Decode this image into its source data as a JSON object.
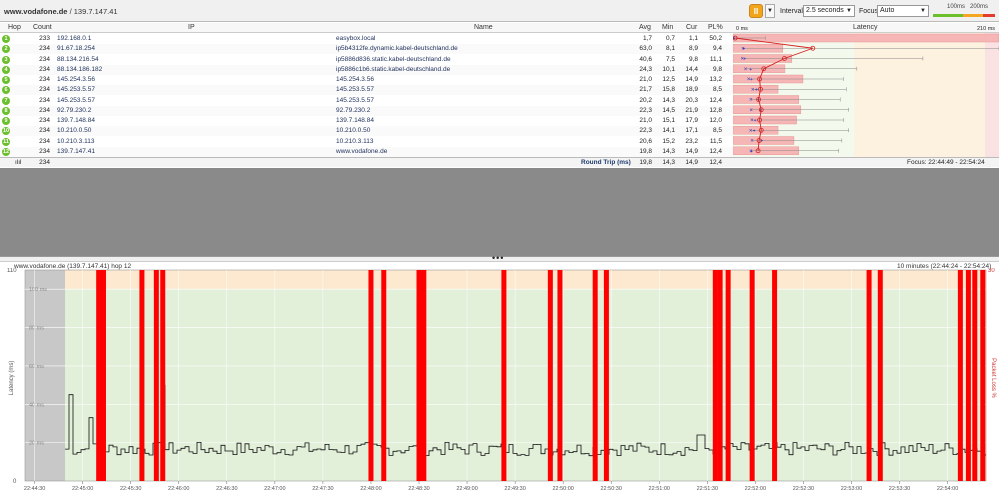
{
  "toolbar": {
    "host": "www.vodafone.de",
    "separator": " / ",
    "ip": "139.7.147.41",
    "pause_icon": "pause-icon",
    "interval_label": "Interval",
    "interval_value": "2.5 seconds",
    "focus_label": "Focus",
    "focus_value": "Auto",
    "legend_100": "100ms",
    "legend_200": "200ms"
  },
  "colors": {
    "good": "#6cbf2c",
    "warn": "#f5a623",
    "bad": "#e33b2e",
    "loss": "#ff0000",
    "graph_green": "#e2efd9",
    "graph_orange": "#fde9cf",
    "graph_red": "#f8dcdc"
  },
  "grid": {
    "headers": {
      "hop": "Hop",
      "count": "Count",
      "ip": "IP",
      "name": "Name",
      "avg": "Avg",
      "min": "Min",
      "cur": "Cur",
      "pl": "PL%",
      "latency": "Latency",
      "scale_min": "0 ms",
      "scale_max": "210 ms"
    },
    "rows": [
      {
        "hop": "1",
        "count": "233",
        "ip": "192.168.0.1",
        "name": "easybox.local",
        "avg": "1,7",
        "min": "0,7",
        "cur": "1,1",
        "pl": "50,2"
      },
      {
        "hop": "2",
        "count": "234",
        "ip": "91.67.18.254",
        "name": "ip5b4312fe.dynamic.kabel-deutschland.de",
        "avg": "63,0",
        "min": "8,1",
        "cur": "8,9",
        "pl": "9,4"
      },
      {
        "hop": "3",
        "count": "234",
        "ip": "88.134.216.54",
        "name": "ip5886d836.static.kabel-deutschland.de",
        "avg": "40,6",
        "min": "7,5",
        "cur": "9,8",
        "pl": "11,1"
      },
      {
        "hop": "4",
        "count": "234",
        "ip": "88.134.186.182",
        "name": "ip5886c1b6.static.kabel-deutschland.de",
        "avg": "24,3",
        "min": "10,1",
        "cur": "14,4",
        "pl": "9,8"
      },
      {
        "hop": "5",
        "count": "234",
        "ip": "145.254.3.56",
        "name": "145.254.3.56",
        "avg": "21,0",
        "min": "12,5",
        "cur": "14,9",
        "pl": "13,2"
      },
      {
        "hop": "6",
        "count": "234",
        "ip": "145.253.5.57",
        "name": "145.253.5.57",
        "avg": "21,7",
        "min": "15,8",
        "cur": "18,9",
        "pl": "8,5"
      },
      {
        "hop": "7",
        "count": "234",
        "ip": "145.253.5.57",
        "name": "145.253.5.57",
        "avg": "20,2",
        "min": "14,3",
        "cur": "20,3",
        "pl": "12,4"
      },
      {
        "hop": "8",
        "count": "234",
        "ip": "92.79.230.2",
        "name": "92.79.230.2",
        "avg": "22,3",
        "min": "14,5",
        "cur": "21,9",
        "pl": "12,8"
      },
      {
        "hop": "9",
        "count": "234",
        "ip": "139.7.148.84",
        "name": "139.7.148.84",
        "avg": "21,0",
        "min": "15,1",
        "cur": "17,9",
        "pl": "12,0"
      },
      {
        "hop": "10",
        "count": "234",
        "ip": "10.210.0.50",
        "name": "10.210.0.50",
        "avg": "22,3",
        "min": "14,1",
        "cur": "17,1",
        "pl": "8,5"
      },
      {
        "hop": "11",
        "count": "234",
        "ip": "10.210.3.113",
        "name": "10.210.3.113",
        "avg": "20,6",
        "min": "15,2",
        "cur": "23,2",
        "pl": "11,5"
      },
      {
        "hop": "12",
        "count": "234",
        "ip": "139.7.147.41",
        "name": "www.vodafone.de",
        "avg": "19,8",
        "min": "14,3",
        "cur": "14,9",
        "pl": "12,4"
      }
    ],
    "summary": {
      "count": "234",
      "label": "Round Trip (ms)",
      "avg": "19,8",
      "min": "14,3",
      "cur": "14,9",
      "pl": "12,4",
      "focus": "Focus: 22:44:49 - 22:54:24"
    }
  },
  "graph": {
    "title": "www.vodafone.de (139.7.147.41) hop 12",
    "range": "10 minutes (22:44:24 - 22:54:24)",
    "ylabel": "Latency (ms)",
    "y2label": "Packet Loss %",
    "y_max_label": "110",
    "y_min_label": "0",
    "y2_max_label": "30",
    "inner_labels": [
      "100 ms",
      "80 ms",
      "60 ms",
      "40 ms",
      "20 ms"
    ],
    "x_labels": [
      "22:44:30",
      "22:45:00",
      "22:45:30",
      "22:46:00",
      "22:46:30",
      "22:47:00",
      "22:47:30",
      "22:48:00",
      "22:48:30",
      "22:49:00",
      "22:49:30",
      "22:50:00",
      "22:50:30",
      "22:51:00",
      "22:51:30",
      "22:52:00",
      "22:52:30",
      "22:53:00",
      "22:53:30",
      "22:54:00"
    ]
  },
  "chart_data": {
    "type": "line",
    "title": "",
    "xlabel": "",
    "ylabel": "Latency (ms)",
    "ylim": [
      0,
      110
    ],
    "x_start": "22:44:24",
    "x_end": "22:54:24",
    "loss_times": [
      "22:45:10",
      "22:45:13",
      "22:45:37",
      "22:45:46",
      "22:45:50",
      "22:48:00",
      "22:48:08",
      "22:48:30",
      "22:48:33",
      "22:49:23",
      "22:49:52",
      "22:49:58",
      "22:50:20",
      "22:50:27",
      "22:51:35",
      "22:51:38",
      "22:51:43",
      "22:51:58",
      "22:52:12",
      "22:53:11",
      "22:53:18",
      "22:54:08",
      "22:54:13",
      "22:54:17",
      "22:54:22"
    ],
    "spikes": [
      {
        "time": "22:44:52",
        "value": 45
      },
      {
        "time": "22:45:04",
        "value": 33
      },
      {
        "time": "22:45:49",
        "value": 50
      },
      {
        "time": "22:48:29",
        "value": 96
      },
      {
        "time": "22:51:25",
        "value": 24
      }
    ],
    "baseline": 16
  }
}
